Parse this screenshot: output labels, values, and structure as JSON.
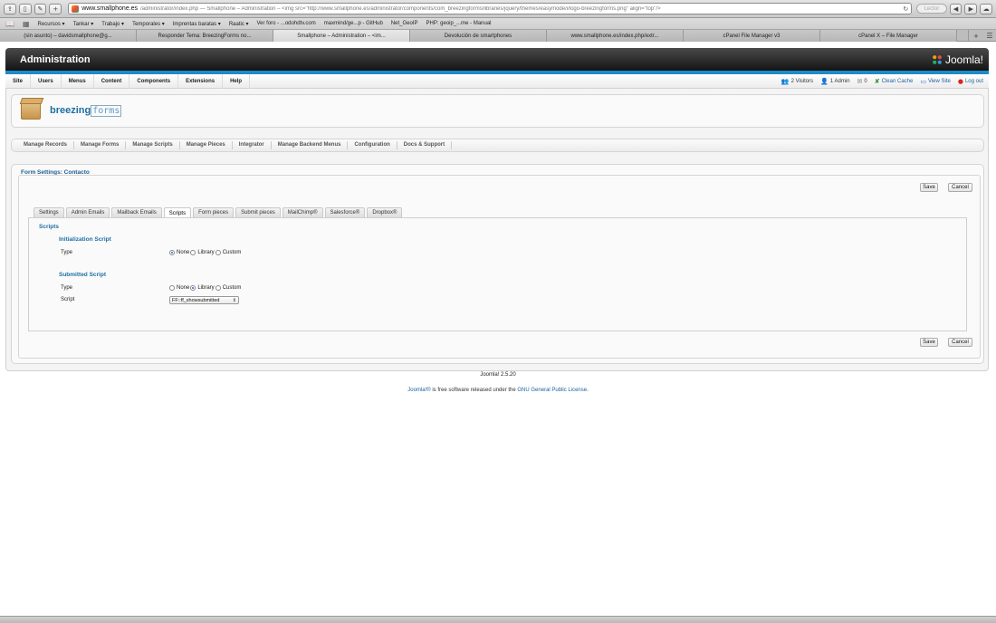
{
  "browser": {
    "url_domain": "www.smallphone.es",
    "url_rest": "/administrator/index.php — Smallphone – Administration – <img src=\"http://www.smallphone.es/administrator/components/com_breezingforms/libraries/jquery/themes/easymode/i/logo-breezingforms.png\" align=\"top\"/>",
    "reader_label": "Lector",
    "bookmarks": [
      "Recursos ▾",
      "Tankar ▾",
      "Trabajo ▾",
      "Temporales ▾",
      "Imprentas baratas ▾",
      "Raatic ▾",
      "Ver foro - ...odohdtv.com",
      "maxmind/ge...p - GitHub",
      "Net_GeoIP",
      "PHP: geoip_...me - Manual"
    ],
    "tabs": [
      "(sin asunto) – davidsmallphone@g...",
      "Responder Tema: BreezingForms no...",
      "Smallphone – Administration – <im...",
      "Devolución de smartphones",
      "www.smallphone.es/index.php/extr...",
      "cPanel File Manager v3",
      "cPanel X – File Manager"
    ],
    "active_tab_index": 2
  },
  "header": {
    "title": "Administration",
    "brand": "Joomla!"
  },
  "menu": {
    "items": [
      "Site",
      "Users",
      "Menus",
      "Content",
      "Components",
      "Extensions",
      "Help"
    ],
    "status": {
      "visitors": "2 Visitors",
      "admin": "1 Admin",
      "messages": "0",
      "clean_cache": "Clean Cache",
      "view_site": "View Site",
      "logout": "Log out"
    }
  },
  "logo": {
    "brand_bold": "breezing",
    "brand_light": "forms"
  },
  "submenu": {
    "items": [
      "Manage Records",
      "Manage Forms",
      "Manage Scripts",
      "Manage Pieces",
      "Integrator",
      "Manage Backend Menus",
      "Configuration",
      "Docs & Support"
    ]
  },
  "form": {
    "title": "Form Settings: Contacto",
    "save_label": "Save",
    "cancel_label": "Cancel",
    "tabs": [
      "Settings",
      "Admin Emails",
      "Mailback Emails",
      "Scripts",
      "Form pieces",
      "Submit pieces",
      "MailChimp®",
      "Salesforce®",
      "Dropbox®"
    ],
    "active_tab": "Scripts",
    "scripts": {
      "section_title": "Scripts",
      "init_title": "Initialization Script",
      "init_type_label": "Type",
      "init_options": [
        "None",
        "Library",
        "Custom"
      ],
      "init_selected": "None",
      "submit_title": "Submitted Script",
      "submit_type_label": "Type",
      "submit_options": [
        "None",
        "Library",
        "Custom"
      ],
      "submit_selected": "Library",
      "script_label": "Script",
      "script_value": "FF::ff_showsubmitted"
    }
  },
  "footer": {
    "version": "Joomla! 2.5.20",
    "license_link": "Joomla!®",
    "license_mid": " is free software released under the ",
    "license_link2": "GNU General Public License",
    "license_end": "."
  },
  "colors": {
    "accent_blue": "#1e8ac8",
    "header_dark": "#141414",
    "link": "#1a5e9c"
  }
}
